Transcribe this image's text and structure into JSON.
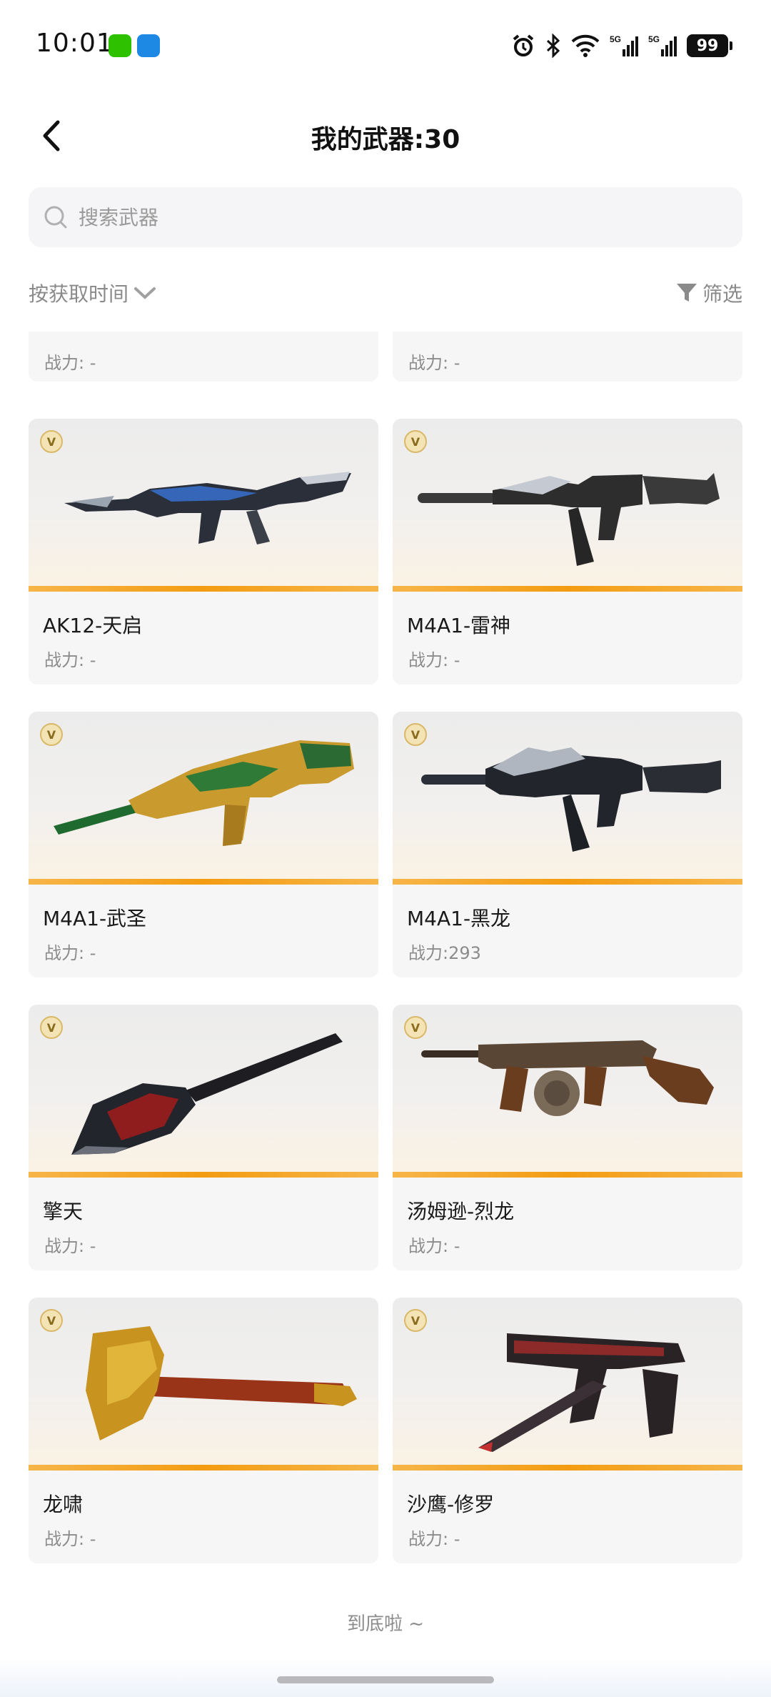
{
  "status_bar": {
    "time": "10:01",
    "network_1": "5G",
    "network_2": "5G",
    "battery": "99"
  },
  "header": {
    "title": "我的武器:30"
  },
  "search": {
    "placeholder": "搜索武器"
  },
  "toolbar": {
    "sort_label": "按获取时间",
    "filter_label": "筛选"
  },
  "partial_row": [
    {
      "power": "战力: -"
    },
    {
      "power": "战力: -"
    }
  ],
  "weapons": [
    {
      "name": "AK12-天启",
      "power": "战力: -",
      "badge": "V",
      "icon": "rifle-icon"
    },
    {
      "name": "M4A1-雷神",
      "power": "战力: -",
      "badge": "V",
      "icon": "rifle-icon"
    },
    {
      "name": "M4A1-武圣",
      "power": "战力: -",
      "badge": "V",
      "icon": "rifle-icon"
    },
    {
      "name": "M4A1-黑龙",
      "power": "战力:293",
      "badge": "V",
      "icon": "rifle-icon"
    },
    {
      "name": "擎天",
      "power": "战力: -",
      "badge": "V",
      "icon": "shovel-icon"
    },
    {
      "name": "汤姆逊-烈龙",
      "power": "战力: -",
      "badge": "V",
      "icon": "smg-icon"
    },
    {
      "name": "龙啸",
      "power": "战力: -",
      "badge": "V",
      "icon": "axe-icon"
    },
    {
      "name": "沙鹰-修罗",
      "power": "战力: -",
      "badge": "V",
      "icon": "pistol-icon"
    }
  ],
  "footer": {
    "end_text": "到底啦 ~"
  }
}
